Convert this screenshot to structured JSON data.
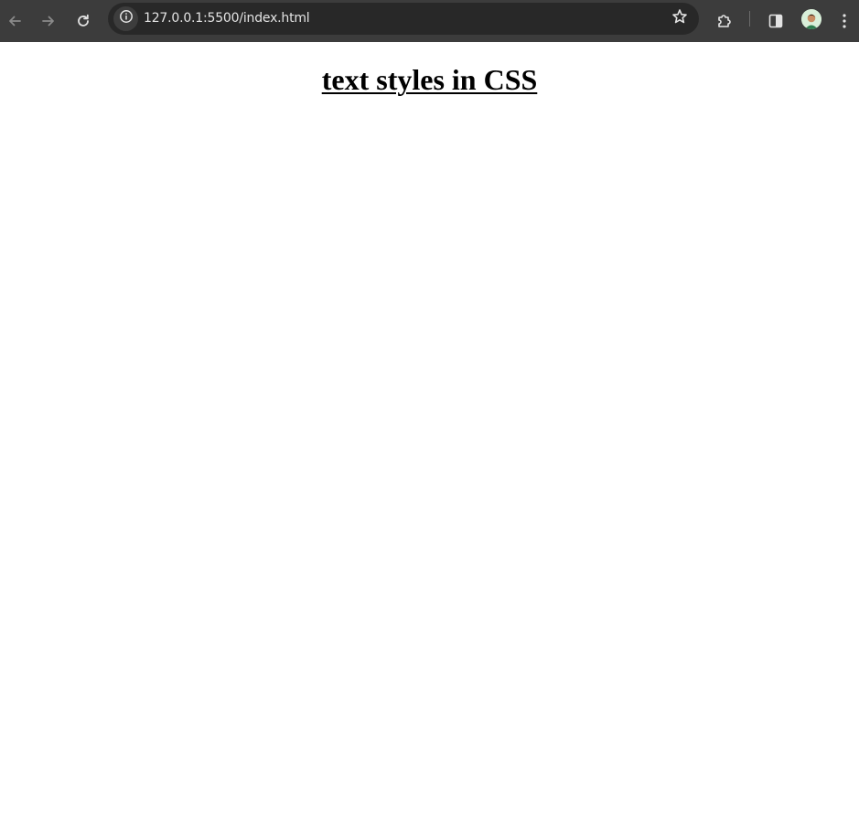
{
  "browser": {
    "url": "127.0.0.1:5500/index.html",
    "icons": {
      "back": "arrow-left-icon",
      "forward": "arrow-right-icon",
      "reload": "reload-icon",
      "site_info": "info-icon",
      "bookmark": "star-icon",
      "extensions": "puzzle-icon",
      "side_panel": "side-panel-icon",
      "profile": "avatar",
      "menu": "kebab-menu-icon"
    },
    "colors": {
      "toolbar": "#3c3c3c",
      "omnibox": "#282828",
      "url_text": "#e3e3e3",
      "icon": "#e3e3e3",
      "icon_disabled": "#8a8a8a"
    }
  },
  "page": {
    "heading": "text styles in CSS",
    "background": "#ffffff"
  }
}
